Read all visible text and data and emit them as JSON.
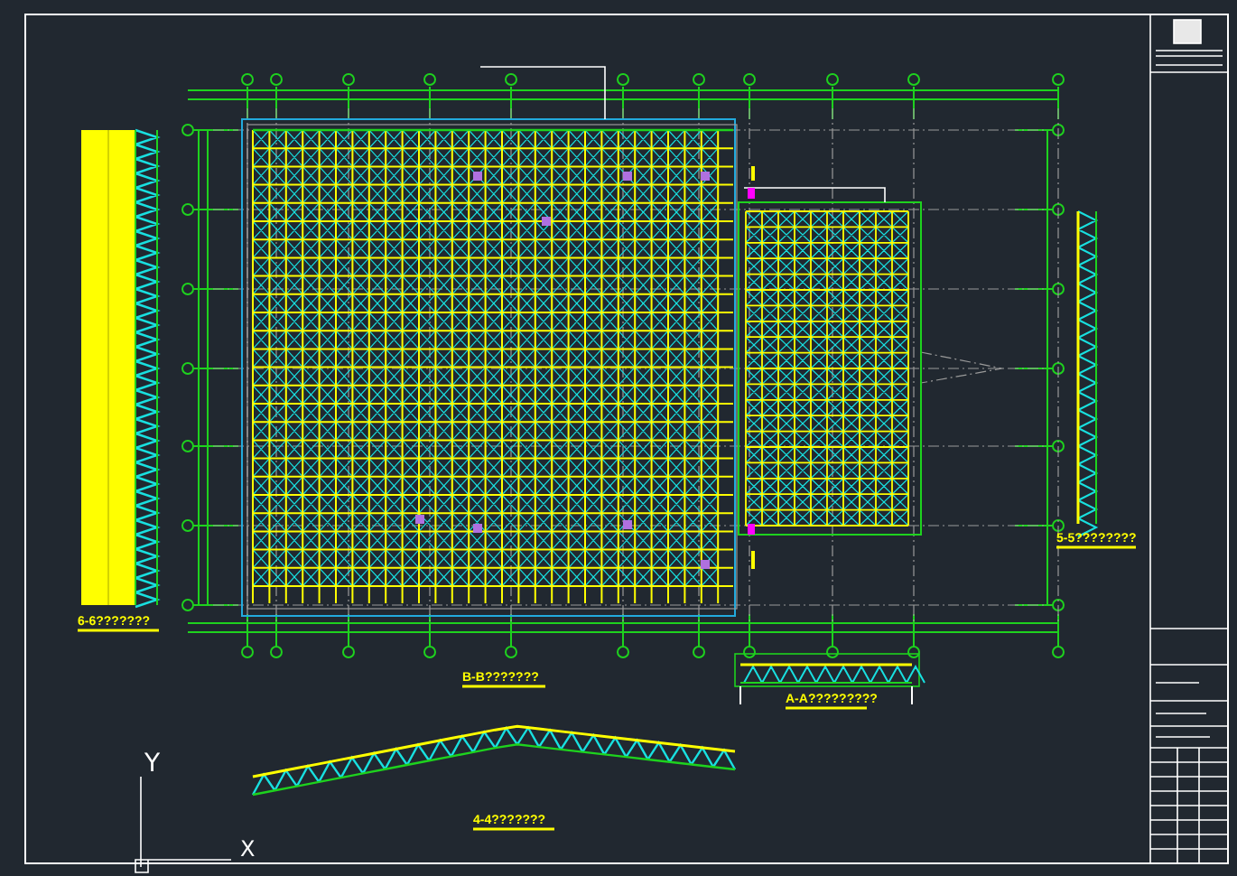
{
  "section_labels": [
    {
      "text": "6-6???????"
    },
    {
      "text": "B-B???????"
    },
    {
      "text": "A-A?????????"
    },
    {
      "text": "4-4???????"
    },
    {
      "text": "5-5????????"
    }
  ],
  "ucs": {
    "y_label": "Y",
    "x_label": "X"
  }
}
